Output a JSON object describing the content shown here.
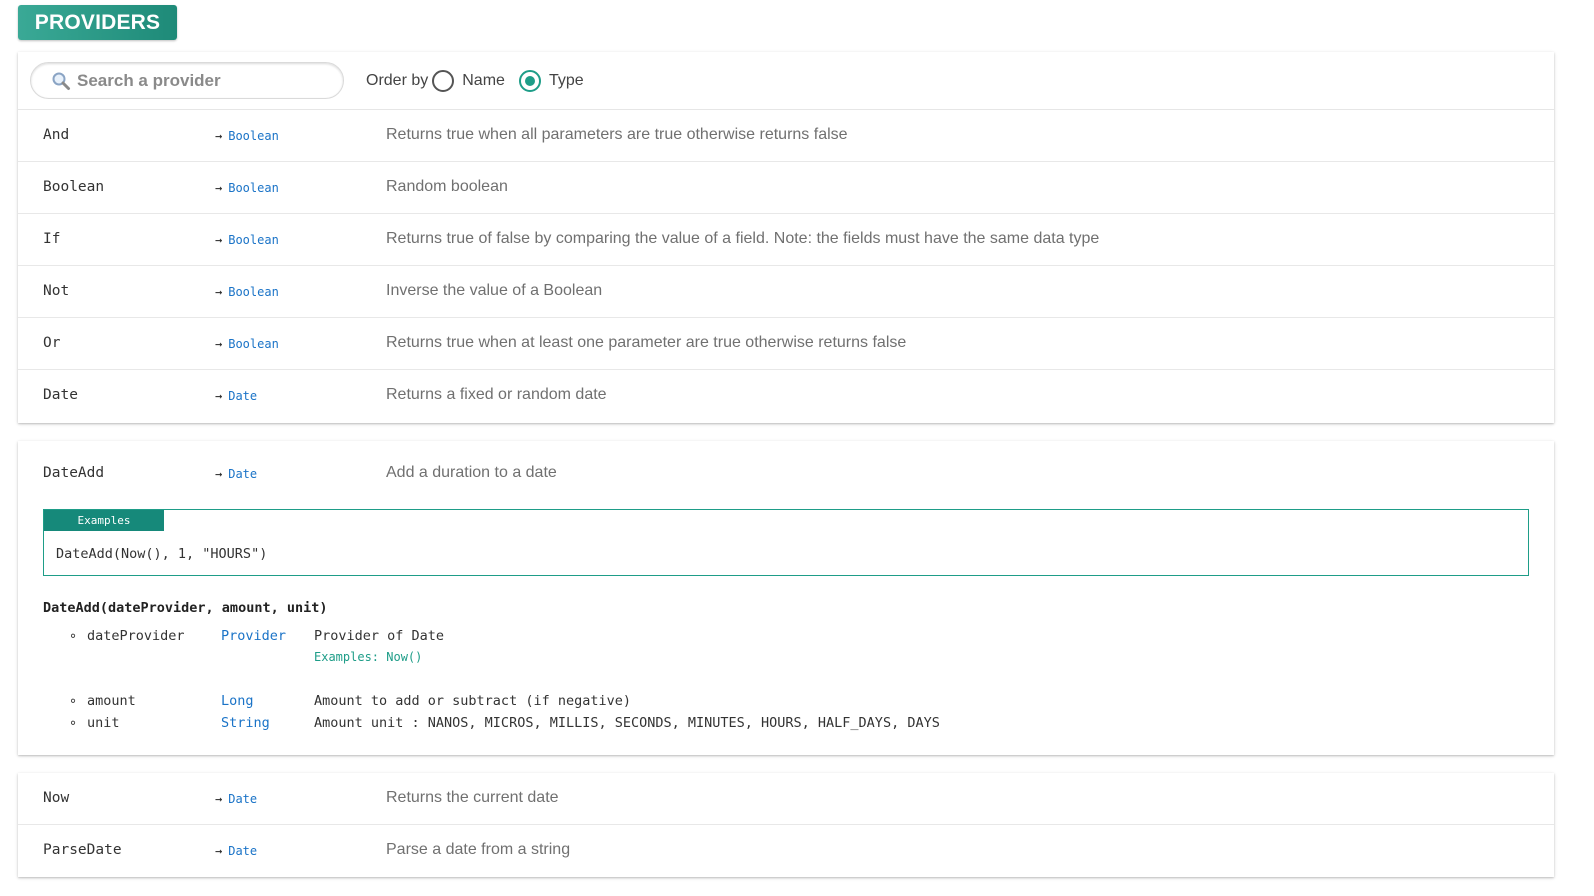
{
  "header": {
    "title": "PROVIDERS"
  },
  "search": {
    "placeholder": "Search a provider",
    "value": ""
  },
  "order": {
    "label": "Order by",
    "options": [
      {
        "label": "Name",
        "selected": false
      },
      {
        "label": "Type",
        "selected": true
      }
    ]
  },
  "rows_top": [
    {
      "name": "And",
      "type": "Boolean",
      "description": "Returns true when all parameters are true otherwise returns false"
    },
    {
      "name": "Boolean",
      "type": "Boolean",
      "description": "Random boolean"
    },
    {
      "name": "If",
      "type": "Boolean",
      "description": "Returns true of false by comparing the value of a field. Note: the fields must have the same data type"
    },
    {
      "name": "Not",
      "type": "Boolean",
      "description": "Inverse the value of a Boolean"
    },
    {
      "name": "Or",
      "type": "Boolean",
      "description": "Returns true when at least one parameter are true otherwise returns false"
    },
    {
      "name": "Date",
      "type": "Date",
      "description": "Returns a fixed or random date"
    }
  ],
  "expanded": {
    "name": "DateAdd",
    "type": "Date",
    "description": "Add a duration to a date",
    "examples_label": "Examples",
    "example_code": "DateAdd(Now(), 1, \"HOURS\")",
    "signature": "DateAdd(dateProvider, amount, unit)",
    "params": [
      {
        "bullet": "∘",
        "name": "dateProvider",
        "type": "Provider",
        "description": "Provider of Date"
      },
      {
        "bullet": "∘",
        "name": "amount",
        "type": "Long",
        "description": "Amount to add or subtract (if negative)"
      },
      {
        "bullet": "∘",
        "name": "unit",
        "type": "String",
        "description": "Amount unit : NANOS, MICROS, MILLIS, SECONDS, MINUTES, HOURS, HALF_DAYS, DAYS"
      }
    ],
    "param_example": "Examples: Now()"
  },
  "rows_bottom": [
    {
      "name": "Now",
      "type": "Date",
      "description": "Returns the current date"
    },
    {
      "name": "ParseDate",
      "type": "Date",
      "description": "Parse a date from a string"
    }
  ],
  "arrow": "→",
  "icons": {
    "search": "search-icon"
  },
  "colors": {
    "accent": "#1e9d88",
    "link": "#1a73c7",
    "header": "#2a9b87"
  }
}
